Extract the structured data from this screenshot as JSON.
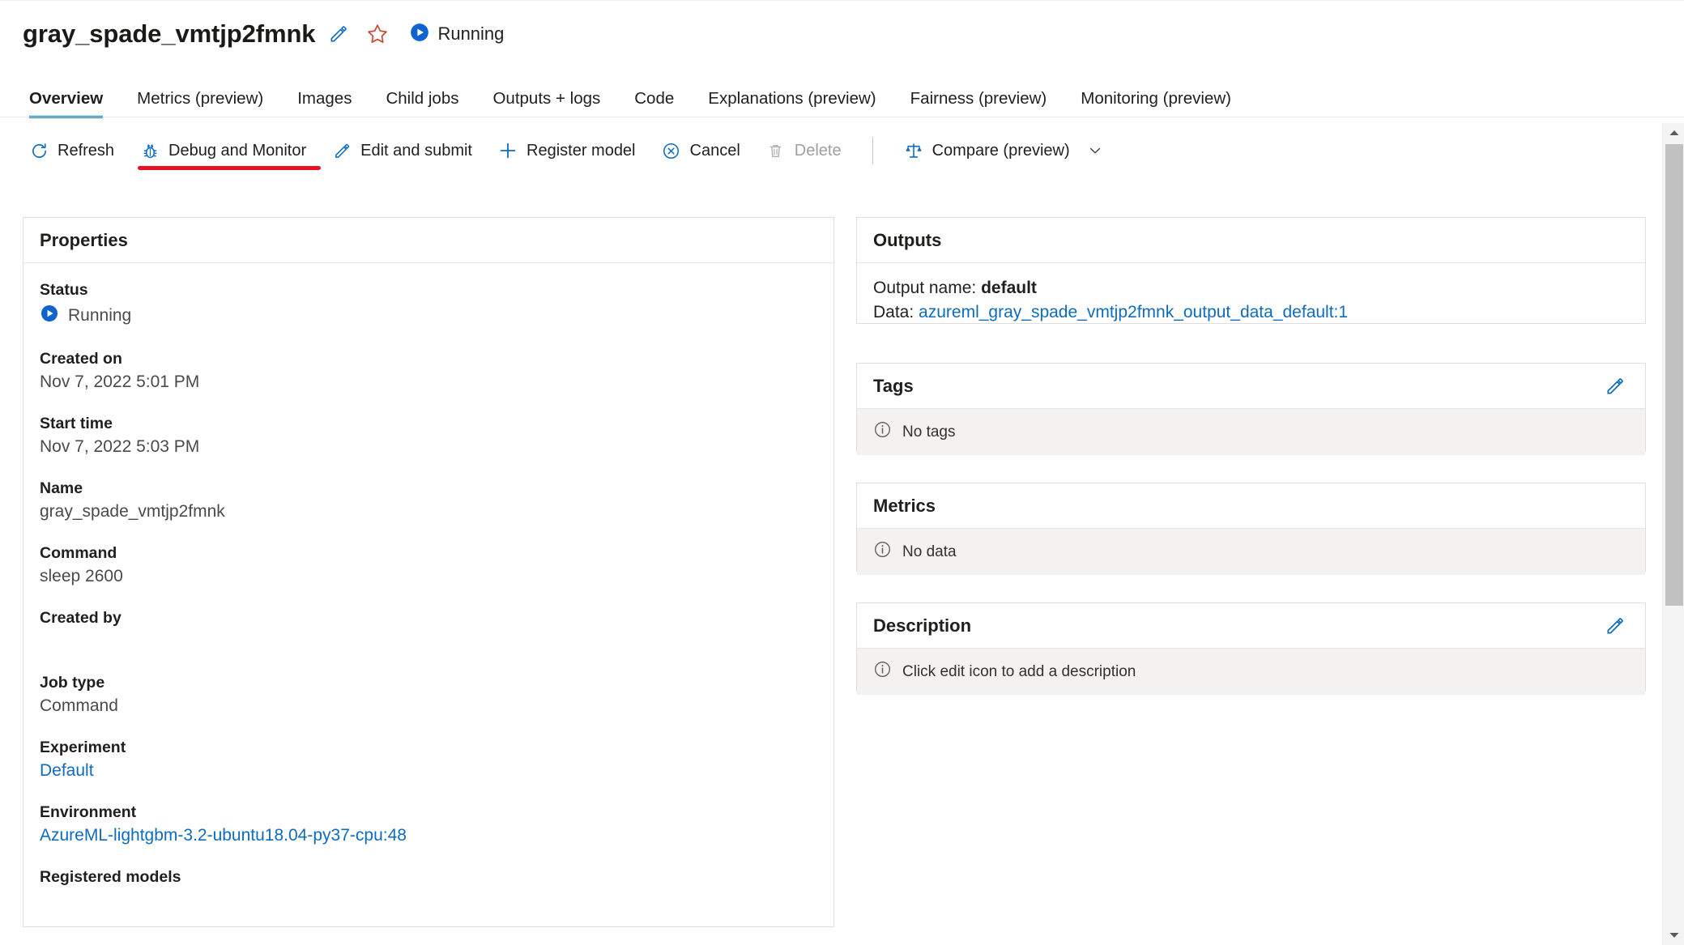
{
  "header": {
    "job_title": "gray_spade_vmtjp2fmnk",
    "edit_icon": "pencil-icon",
    "favorite_icon": "star-icon",
    "status_icon": "running-play-icon",
    "status_text": "Running"
  },
  "tabs": [
    {
      "label": "Overview",
      "active": true
    },
    {
      "label": "Metrics (preview)",
      "active": false
    },
    {
      "label": "Images",
      "active": false
    },
    {
      "label": "Child jobs",
      "active": false
    },
    {
      "label": "Outputs + logs",
      "active": false
    },
    {
      "label": "Code",
      "active": false
    },
    {
      "label": "Explanations (preview)",
      "active": false
    },
    {
      "label": "Fairness (preview)",
      "active": false
    },
    {
      "label": "Monitoring (preview)",
      "active": false
    }
  ],
  "toolbar": {
    "refresh_label": "Refresh",
    "debug_label": "Debug and Monitor",
    "edit_submit_label": "Edit and submit",
    "register_model_label": "Register model",
    "cancel_label": "Cancel",
    "delete_label": "Delete",
    "compare_label": "Compare (preview)",
    "icons": {
      "refresh": "refresh-icon",
      "debug": "bug-icon",
      "edit_submit": "pencil-icon",
      "register_model": "plus-icon",
      "cancel": "cancel-circle-icon",
      "delete": "trash-icon",
      "compare": "scales-icon",
      "compare_chevron": "chevron-down-icon"
    }
  },
  "annotation": {
    "target": "Debug and Monitor",
    "color": "#e81123"
  },
  "properties": {
    "title": "Properties",
    "items": [
      {
        "label": "Status",
        "value": "Running",
        "type": "status"
      },
      {
        "label": "Created on",
        "value": "Nov 7, 2022 5:01 PM",
        "type": "text"
      },
      {
        "label": "Start time",
        "value": "Nov 7, 2022 5:03 PM",
        "type": "text"
      },
      {
        "label": "Name",
        "value": "gray_spade_vmtjp2fmnk",
        "type": "text"
      },
      {
        "label": "Command",
        "value": "sleep 2600",
        "type": "text"
      },
      {
        "label": "Created by",
        "value": "",
        "type": "text"
      },
      {
        "label": "Job type",
        "value": "Command",
        "type": "text"
      },
      {
        "label": "Experiment",
        "value": "Default",
        "type": "link"
      },
      {
        "label": "Environment",
        "value": "AzureML-lightgbm-3.2-ubuntu18.04-py37-cpu:48",
        "type": "link"
      },
      {
        "label": "Registered models",
        "value": "",
        "type": "text"
      }
    ]
  },
  "outputs": {
    "title": "Outputs",
    "output_name_label": "Output name:",
    "output_name_value": "default",
    "data_label": "Data:",
    "data_value": "azureml_gray_spade_vmtjp2fmnk_output_data_default:1"
  },
  "tags": {
    "title": "Tags",
    "empty_text": "No tags",
    "empty_icon": "info-icon",
    "edit_icon": "pencil-icon"
  },
  "metrics": {
    "title": "Metrics",
    "empty_text": "No data",
    "empty_icon": "info-icon"
  },
  "description": {
    "title": "Description",
    "empty_text": "Click edit icon to add a description",
    "empty_icon": "info-icon",
    "edit_icon": "pencil-icon"
  },
  "scrollbar": {
    "up_icon": "caret-up-icon",
    "down_icon": "caret-down-icon"
  },
  "colors": {
    "accent": "#0078d4",
    "link": "#0f6cbd",
    "annotation": "#e81123"
  }
}
